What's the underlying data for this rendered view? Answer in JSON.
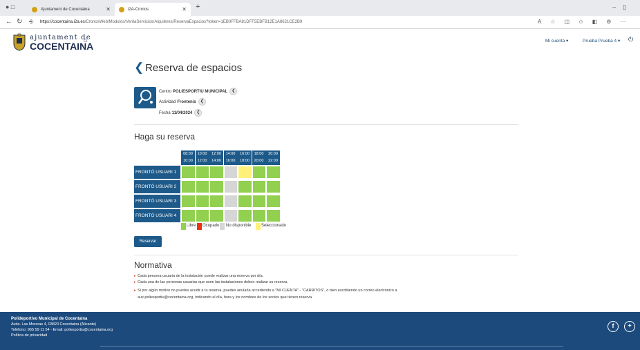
{
  "browser": {
    "tabs": [
      {
        "label": "Ajuntament de Cocentaina"
      },
      {
        "label": "i2A-Cronos"
      }
    ],
    "url_host": "https://cocentaina.i2a.es",
    "url_path": "/CronosWeb/Modulos/VentaServicios/Alquileres/ReservaEspacios?token=1EB0FFBA81DFF5EBFB12E1A8621CE2B9"
  },
  "header": {
    "logo_top": "ajuntament de",
    "logo_bottom": "COCENTAINA",
    "account_menu": "Mi cuenta",
    "user_menu": "Prueba Prueba 4"
  },
  "main": {
    "title": "Reserva de espacios",
    "centro_label": "Centro",
    "centro_value": "POLIESPORTIU MUNICIPAL",
    "actividad_label": "Actividad",
    "actividad_value": "Frontenis",
    "fecha_label": "Fecha",
    "fecha_value": "11/04/2024",
    "booking_title": "Haga su reserva",
    "time_slots": [
      {
        "start": "08:00",
        "end": "10:00"
      },
      {
        "start": "10:00",
        "end": "12:00"
      },
      {
        "start": "12:00",
        "end": "14:00"
      },
      {
        "start": "14:00",
        "end": "16:00"
      },
      {
        "start": "16:00",
        "end": "18:00"
      },
      {
        "start": "18:00",
        "end": "20:00"
      },
      {
        "start": "20:00",
        "end": "22:00"
      }
    ],
    "courts": [
      {
        "name": "FRONTÓ USUARI 1",
        "status": [
          "libre",
          "libre",
          "libre",
          "no_disponible",
          "seleccionado",
          "libre",
          "libre"
        ]
      },
      {
        "name": "FRONTÓ USUARI 2",
        "status": [
          "libre",
          "libre",
          "libre",
          "no_disponible",
          "libre",
          "libre",
          "libre"
        ]
      },
      {
        "name": "FRONTÓ USUARI 3",
        "status": [
          "libre",
          "libre",
          "libre",
          "no_disponible",
          "libre",
          "libre",
          "libre"
        ]
      },
      {
        "name": "FRONTÓ USUARI 4",
        "status": [
          "libre",
          "libre",
          "libre",
          "no_disponible",
          "libre",
          "libre",
          "libre"
        ]
      }
    ],
    "legend": {
      "libre": "Libre",
      "ocupado": "Ocupado",
      "no_disponible": "No disponible",
      "seleccionado": "Seleccionado"
    },
    "colors": {
      "libre": "#92d050",
      "ocupado": "#e8340f",
      "no_disponible": "#d6d6d6",
      "seleccionado": "#fff07a",
      "primary": "#1d5a8a"
    },
    "reserve_button": "Reservar",
    "normativa_title": "Normativa",
    "rules": [
      "Cada persona usuaria de la instalación puede realizar una reserva por día.",
      "Cada una de las personas usuarias que usen las instalaciones deben realizar su reserva.",
      "Si por algún motivo no puedes acudir a tu reserva, puedes anularla accediendo a \"MI CUENTA\" - \"CARRITOS\", o bien escribiendo un correo electrónico a"
    ],
    "rule_continuation": "aux.poliesportiu@cocentaina.org, indicando el día, hora y los nombres de los socios que tienen reserva."
  },
  "footer": {
    "title": "Polideportivo Municipal de Cocentaina",
    "address": "Avda. Las Moreras 4, 03820 Cocentaina (Alicante)",
    "contact": "Teléfono: 965 59 11 54 - Email: poliesportiu@cocentaina.org",
    "privacy": "Política de privacidad"
  }
}
